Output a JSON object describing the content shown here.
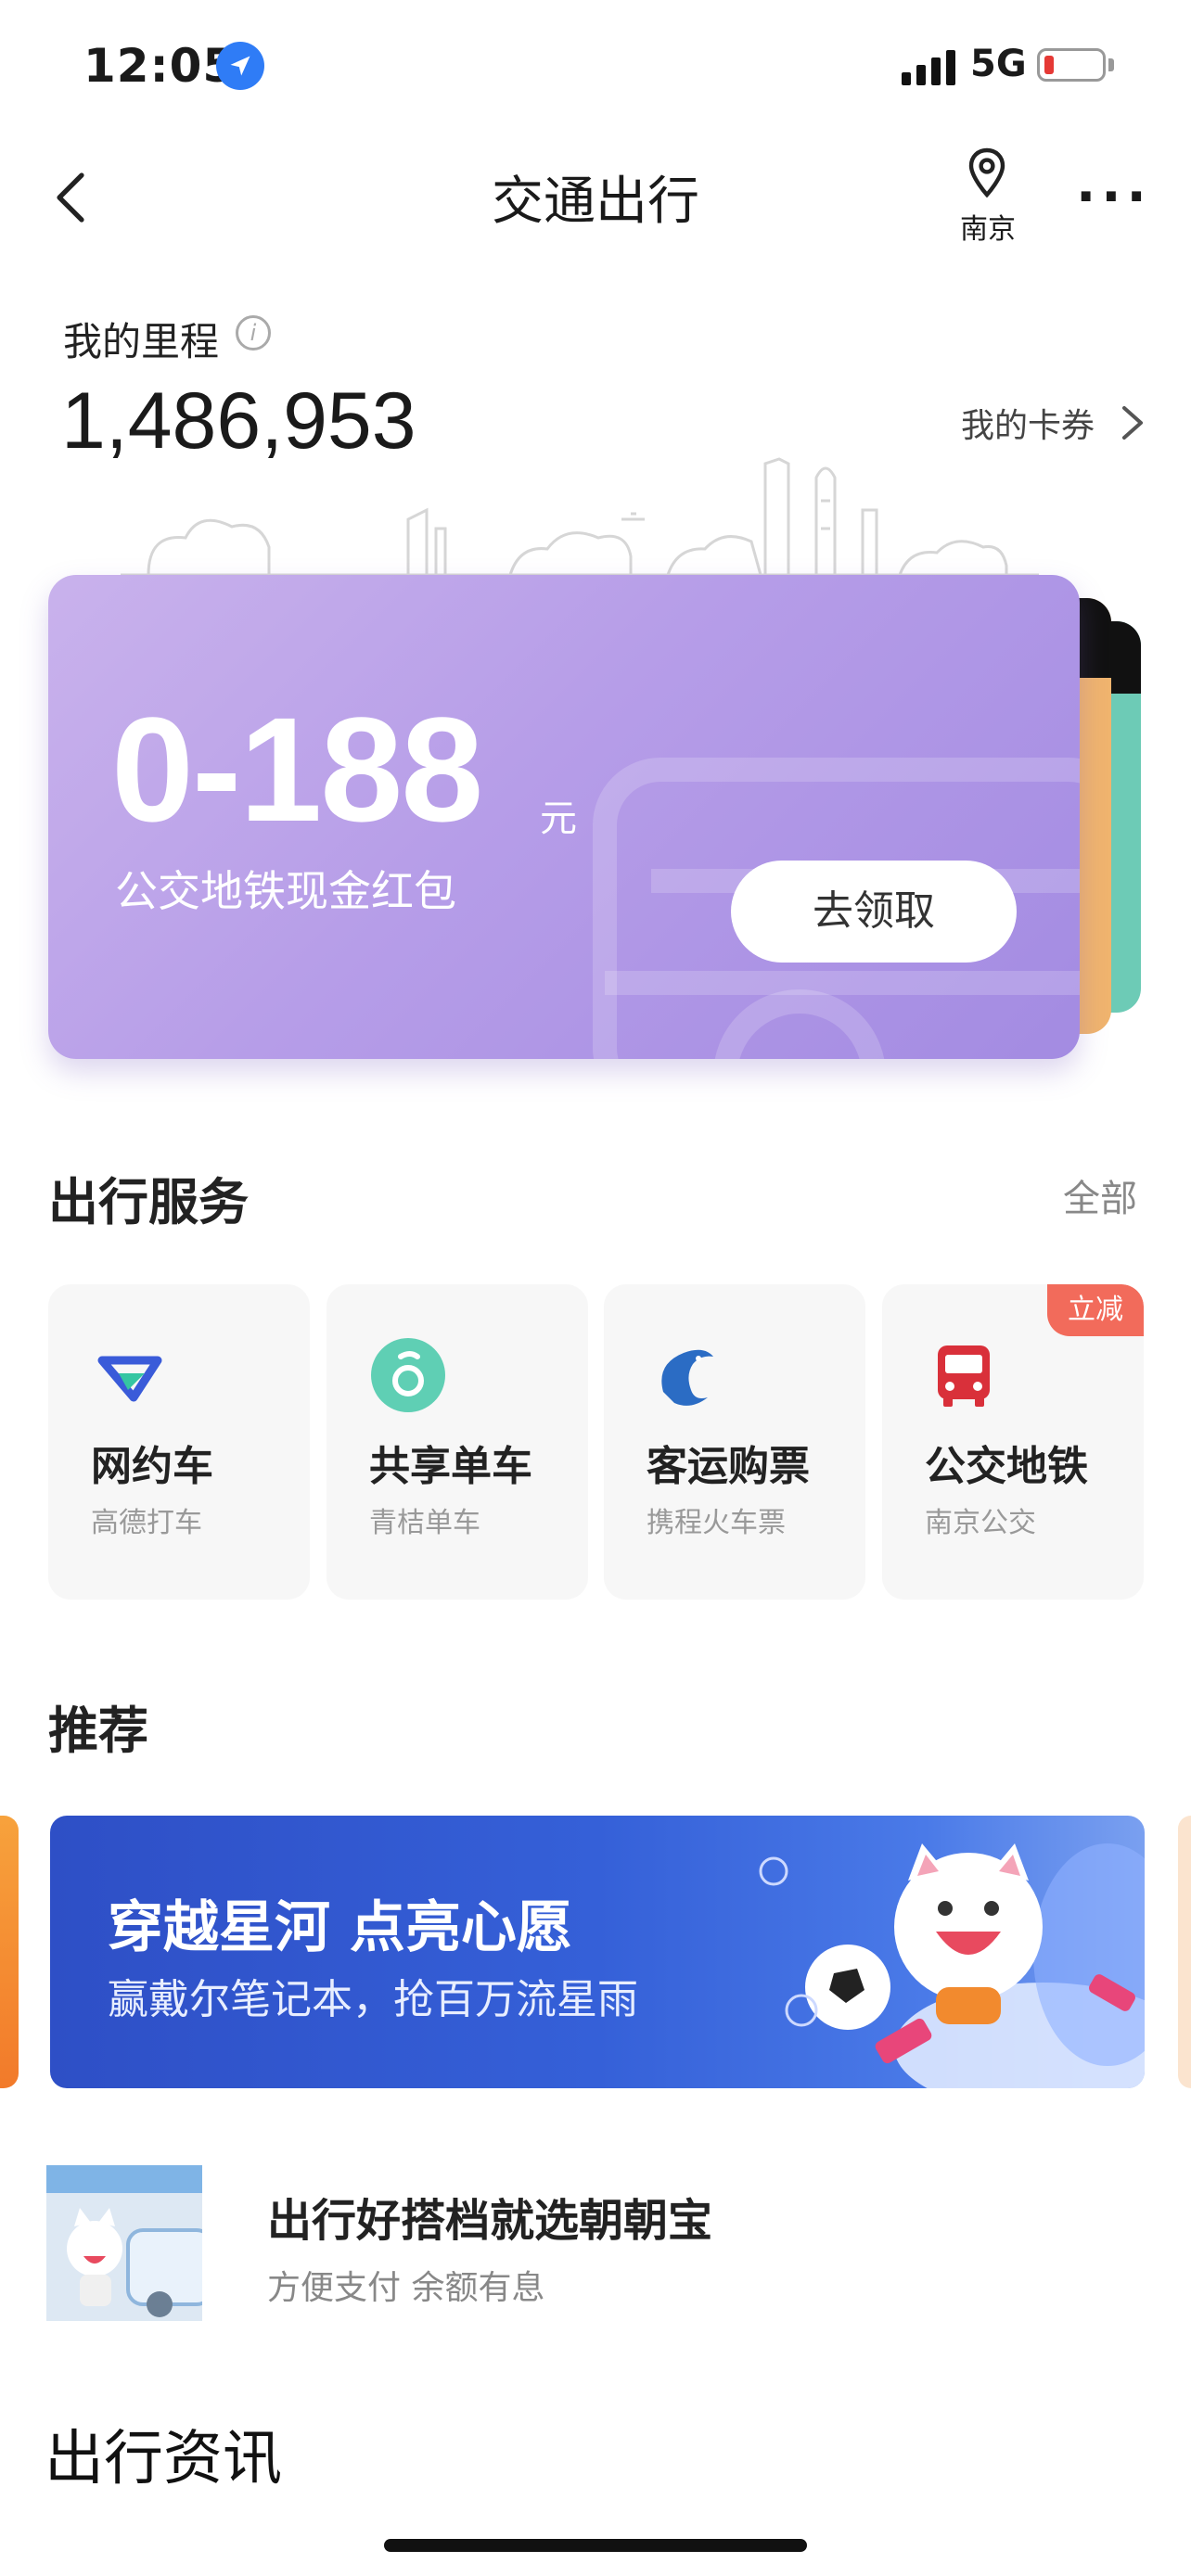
{
  "status_bar": {
    "time": "12:05",
    "network": "5G"
  },
  "nav": {
    "title": "交通出行",
    "city": "南京",
    "more": "···"
  },
  "mileage": {
    "label": "我的里程",
    "value": "1,486,953",
    "coupons_label": "我的卡券"
  },
  "promo_card": {
    "amount": "0-188",
    "unit": "元",
    "description": "公交地铁现金红包",
    "button_label": "去领取"
  },
  "services": {
    "title": "出行服务",
    "all_label": "全部",
    "items": [
      {
        "title": "网约车",
        "subtitle": "高德打车",
        "icon": "ride-hailing-icon"
      },
      {
        "title": "共享单车",
        "subtitle": "青桔单车",
        "icon": "bike-share-icon"
      },
      {
        "title": "客运购票",
        "subtitle": "携程火车票",
        "icon": "dolphin-ticket-icon"
      },
      {
        "title": "公交地铁",
        "subtitle": "南京公交",
        "icon": "bus-icon",
        "badge": "立减"
      }
    ]
  },
  "recommend": {
    "title": "推荐",
    "banner": {
      "headline": "穿越星河 点亮心愿",
      "subline": "赢戴尔笔记本，抢百万流星雨"
    },
    "item": {
      "title": "出行好搭档就选朝朝宝",
      "subtitle": "方便支付 余额有息"
    }
  },
  "news": {
    "title": "出行资讯"
  },
  "colors": {
    "accent_blue": "#2f7cf6",
    "promo_purple": "#b69de8",
    "badge_red": "#f26b5b",
    "bike_teal": "#5fcfb4",
    "bus_red": "#d9303a"
  }
}
